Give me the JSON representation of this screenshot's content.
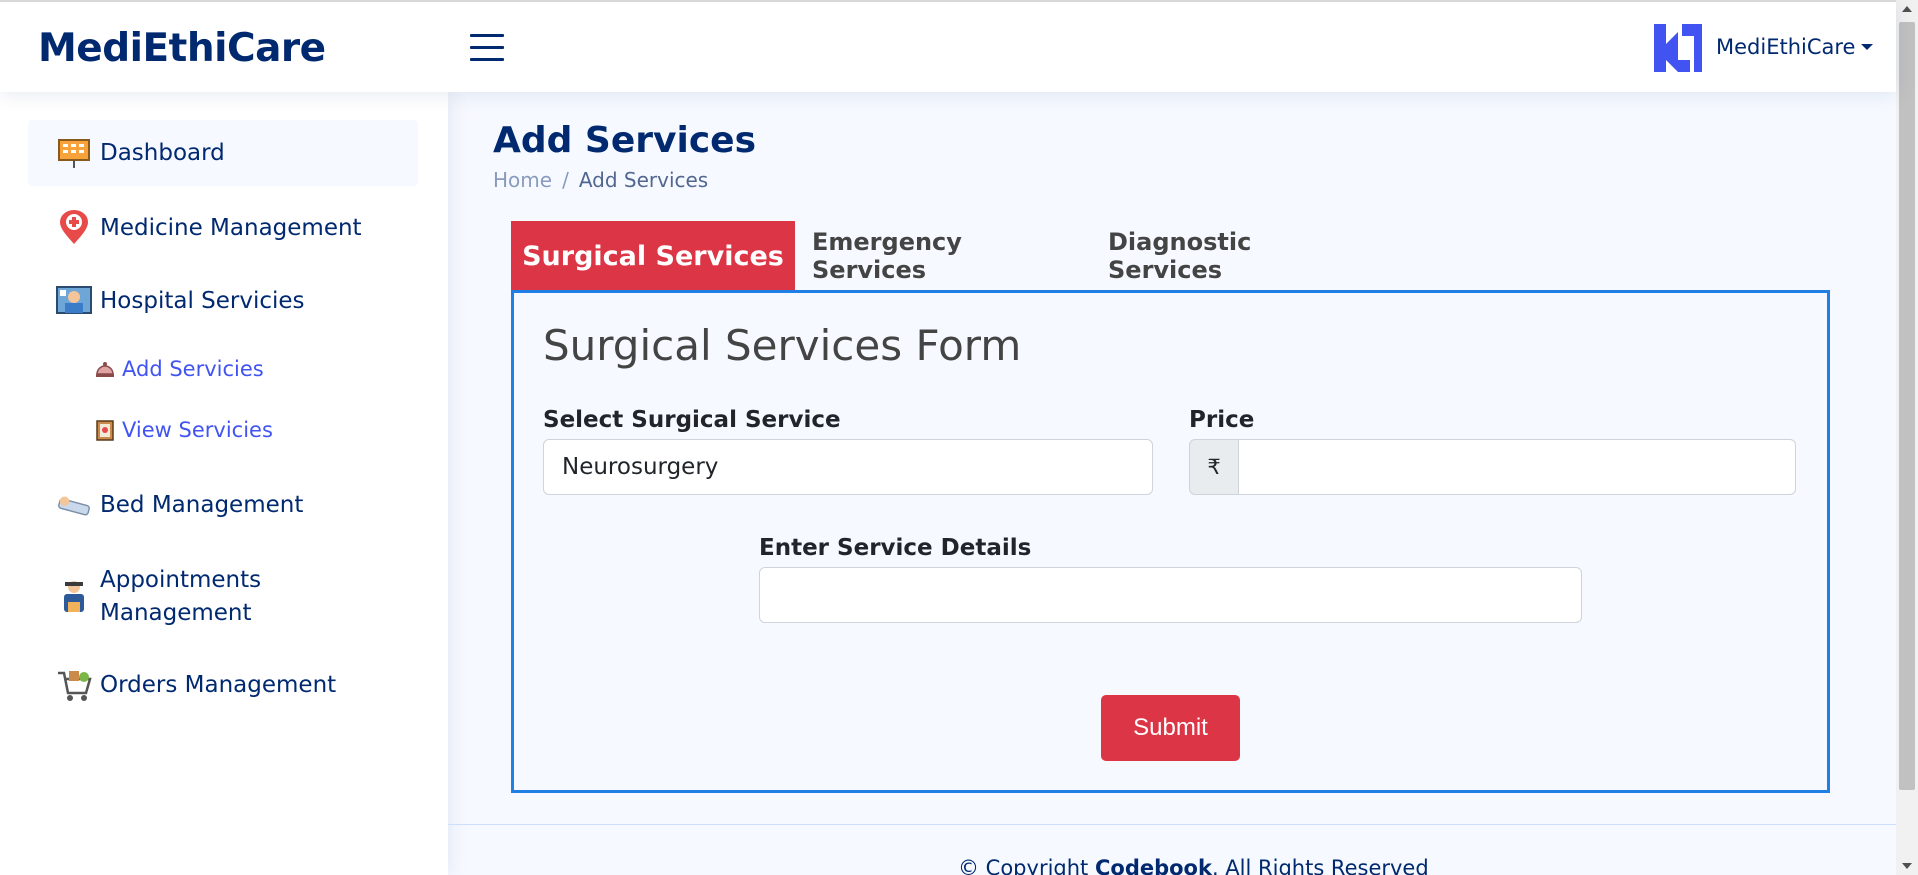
{
  "header": {
    "logo_text": "MediEthiCare",
    "profile_name": "MediEthiCare"
  },
  "sidebar": {
    "items": [
      {
        "label": "Dashboard",
        "icon": "dashboard-board-icon"
      },
      {
        "label": "Medicine Management",
        "icon": "medical-pin-icon"
      },
      {
        "label": "Hospital Servicies",
        "icon": "hospital-patient-icon"
      },
      {
        "label": "Bed Management",
        "icon": "bed-icon"
      },
      {
        "label": "Appointments Management",
        "icon": "doctor-icon"
      },
      {
        "label": "Orders Management",
        "icon": "shopping-cart-icon"
      }
    ],
    "subitems": [
      {
        "label": "Add Servicies",
        "icon": "service-bell-icon"
      },
      {
        "label": "View Servicies",
        "icon": "clipboard-icon"
      }
    ]
  },
  "page": {
    "title": "Add Services",
    "breadcrumb": {
      "home": "Home",
      "separator": "/",
      "current": "Add Services"
    }
  },
  "tabs": [
    {
      "label": "Surgical Services",
      "active": true
    },
    {
      "label": "Emergency Services",
      "active": false
    },
    {
      "label": "Diagnostic Services",
      "active": false
    }
  ],
  "form": {
    "title": "Surgical Services Form",
    "service_label": "Select Surgical Service",
    "service_value": "Neurosurgery",
    "price_label": "Price",
    "currency_symbol": "₹",
    "price_value": "",
    "details_label": "Enter Service Details",
    "details_value": "",
    "submit_label": "Submit"
  },
  "footer": {
    "prefix": "© Copyright",
    "brand": "Codebook",
    "suffix": ". All Rights Reserved"
  },
  "colors": {
    "primary_navy": "#012970",
    "accent_red": "#dc3545",
    "link_blue": "#4154f1",
    "card_border": "#1f7fe5"
  }
}
